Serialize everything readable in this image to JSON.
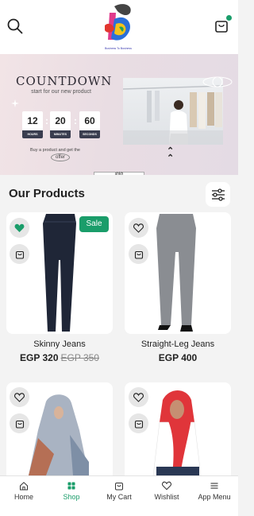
{
  "header": {
    "logo_tagline": "Business To Business",
    "cart_has_items": true
  },
  "banner": {
    "title": "COUNTDOWN",
    "subtitle": "start for our new product",
    "countdown": [
      {
        "value": "12",
        "label": "HOURS"
      },
      {
        "value": "20",
        "label": "MINUTES"
      },
      {
        "value": "60",
        "label": "SECONDS"
      }
    ],
    "note": "Buy a product and get the",
    "offer_label": "offer",
    "tab_label": "shkh"
  },
  "products_section": {
    "title": "Our Products"
  },
  "products": [
    {
      "name": "Skinny Jeans",
      "price": "EGP 320",
      "old_price": "EGP 350",
      "badge": "Sale",
      "wishlisted": true
    },
    {
      "name": "Straight-Leg Jeans",
      "price": "EGP 400",
      "old_price": "",
      "badge": "",
      "wishlisted": false
    },
    {
      "name": "",
      "price": "",
      "old_price": "",
      "badge": "",
      "wishlisted": false
    },
    {
      "name": "",
      "price": "",
      "old_price": "",
      "badge": "",
      "wishlisted": false
    }
  ],
  "bottom_nav": [
    {
      "label": "Home",
      "icon": "home-icon",
      "active": false
    },
    {
      "label": "Shop",
      "icon": "shop-icon",
      "active": true
    },
    {
      "label": "My Cart",
      "icon": "cart-icon",
      "active": false
    },
    {
      "label": "Wishlist",
      "icon": "heart-icon",
      "active": false
    },
    {
      "label": "App Menu",
      "icon": "menu-icon",
      "active": false
    }
  ],
  "colors": {
    "accent": "#1a9d6a",
    "background": "#f3f3f3",
    "card": "#ffffff"
  }
}
